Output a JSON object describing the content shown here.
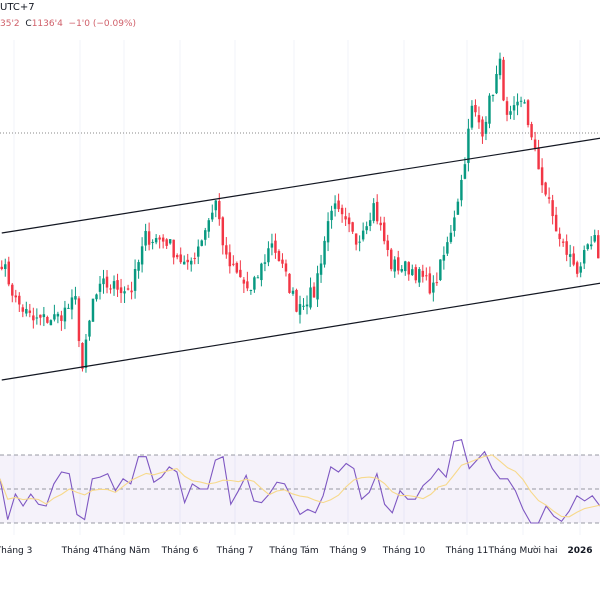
{
  "header": {
    "timezone": "UTC+7",
    "ohlc_low": "35'2",
    "close_label": "C",
    "close": "1136'4",
    "change": "−1'0 (−0.09%)"
  },
  "colors": {
    "up": "#089981",
    "down": "#f23645",
    "rsi": "#7e57c2",
    "rsi_ma": "#f7d98b",
    "band": "#7e57c2",
    "channel": "#131722"
  },
  "time_axis": [
    "Tháng 3",
    "Tháng 4",
    "Tháng Năm",
    "Tháng 6",
    "Tháng 7",
    "Tháng Tám",
    "Tháng 9",
    "Tháng 10",
    "Tháng 11",
    "Tháng Mười hai",
    "2026"
  ],
  "chart_data": [
    {
      "type": "candlestick",
      "bars": 171,
      "ylim": [
        1070,
        1170
      ],
      "close_path": [
        [
          0,
          1104
        ],
        [
          4,
          1094
        ],
        [
          9,
          1089
        ],
        [
          16,
          1090
        ],
        [
          21,
          1094
        ],
        [
          23,
          1077
        ],
        [
          26,
          1094
        ],
        [
          29,
          1098
        ],
        [
          37,
          1097
        ],
        [
          41,
          1110
        ],
        [
          47,
          1109
        ],
        [
          53,
          1102
        ],
        [
          57,
          1110
        ],
        [
          61,
          1119
        ],
        [
          64,
          1104
        ],
        [
          71,
          1096
        ],
        [
          77,
          1109
        ],
        [
          84,
          1093
        ],
        [
          89,
          1096
        ],
        [
          94,
          1118
        ],
        [
          101,
          1109
        ],
        [
          106,
          1118
        ],
        [
          111,
          1103
        ],
        [
          117,
          1102
        ],
        [
          123,
          1097
        ],
        [
          127,
          1108
        ],
        [
          131,
          1124
        ],
        [
          134,
          1142
        ],
        [
          137,
          1137
        ],
        [
          140,
          1147
        ],
        [
          142,
          1153
        ],
        [
          144,
          1139
        ],
        [
          149,
          1144
        ],
        [
          151,
          1134
        ],
        [
          154,
          1124
        ],
        [
          159,
          1109
        ],
        [
          164,
          1102
        ],
        [
          169,
          1109
        ],
        [
          171,
          1097
        ]
      ],
      "reference_price": 1136,
      "channel_upper": [
        [
          0,
          1111
        ],
        [
          171,
          1134.75
        ]
      ],
      "channel_lower": [
        [
          0,
          1074.25
        ],
        [
          171,
          1098.5
        ]
      ]
    },
    {
      "type": "line",
      "title": "RSI",
      "ylim": [
        20,
        90
      ],
      "levels": [
        70,
        50,
        30
      ],
      "values": [
        56,
        32,
        47,
        40,
        47,
        41,
        40,
        53,
        60,
        59,
        35,
        32,
        56,
        57,
        59,
        49,
        56,
        53,
        69,
        69,
        54,
        57,
        63,
        60,
        42,
        53,
        50,
        50,
        67,
        69,
        41,
        49,
        58,
        43,
        42,
        47,
        54,
        53,
        44,
        35,
        38,
        36,
        46,
        63,
        60,
        65,
        62,
        44,
        48,
        59,
        41,
        36,
        49,
        44,
        44,
        52,
        56,
        62,
        57,
        78,
        79,
        62,
        67,
        72,
        62,
        56,
        56,
        49,
        38,
        30,
        30,
        40,
        34,
        31,
        37,
        46,
        43,
        46,
        40
      ]
    }
  ]
}
